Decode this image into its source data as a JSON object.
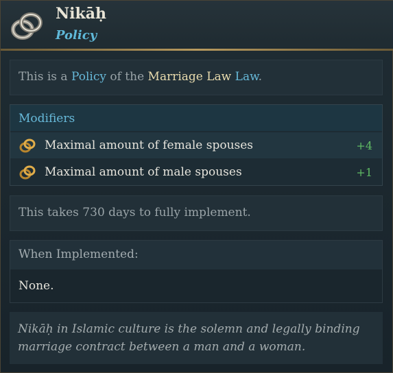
{
  "header": {
    "title": "Nikāḥ",
    "subtitle": "Policy",
    "icon": "rings-icon"
  },
  "description": {
    "prefix": "This is a ",
    "policy_word": "Policy",
    "middle": " of the ",
    "law_name": "Marriage Law",
    "space": " ",
    "law_word": "Law",
    "suffix": "."
  },
  "modifiers": {
    "heading": "Modifiers",
    "items": [
      {
        "label": "Maximal amount of female spouses",
        "value": "+4",
        "icon": "rings-icon"
      },
      {
        "label": "Maximal amount of male spouses",
        "value": "+1",
        "icon": "rings-icon"
      }
    ]
  },
  "duration_text": "This takes 730 days to fully implement.",
  "implemented": {
    "heading": "When Implemented:",
    "body": "None."
  },
  "flavor_text": "Nikāḥ in Islamic culture is the solemn and legally binding marriage contract between a man and a woman.",
  "colors": {
    "accent_blue": "#67b9d9",
    "gold_text": "#e9dcae",
    "positive_green": "#5fbb64",
    "header_rule": "#b89a5e"
  }
}
